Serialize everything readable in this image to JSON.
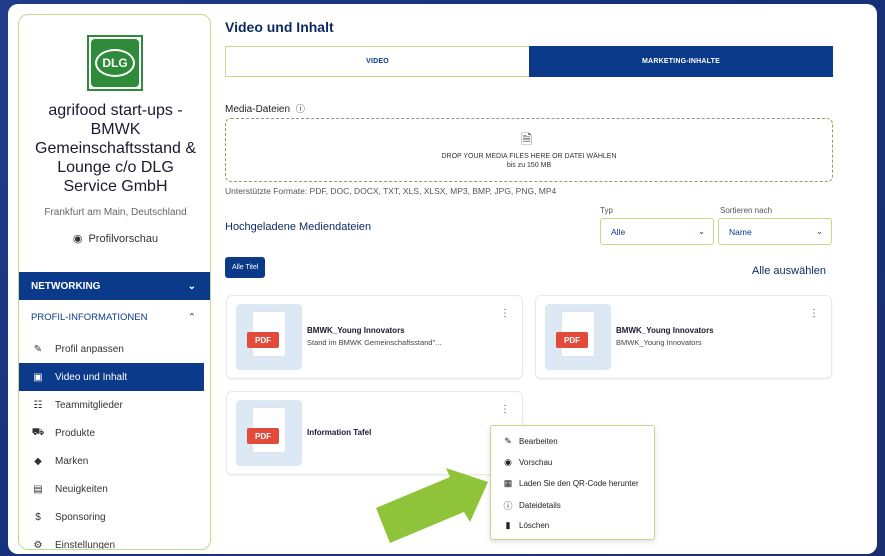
{
  "sidebar": {
    "company_lines": [
      "agrifood start-ups -",
      "BMWK",
      "Gemeinschaftsstand &",
      "Lounge c/o DLG",
      "Service GmbH"
    ],
    "logo_text": "DLG",
    "location": "Frankfurt am Main, Deutschland",
    "preview_label": "Profilvorschau",
    "networking_label": "NETWORKING",
    "profile_info_label": "PROFIL-INFORMATIONEN",
    "items": [
      {
        "label": "Profil anpassen",
        "icon": "pencil-icon"
      },
      {
        "label": "Video und Inhalt",
        "icon": "video-icon"
      },
      {
        "label": "Teammitglieder",
        "icon": "team-icon"
      },
      {
        "label": "Produkte",
        "icon": "cart-icon"
      },
      {
        "label": "Marken",
        "icon": "tag-icon"
      },
      {
        "label": "Neuigkeiten",
        "icon": "news-icon"
      },
      {
        "label": "Sponsoring",
        "icon": "dollar-icon"
      },
      {
        "label": "Einstellungen",
        "icon": "gear-icon"
      }
    ],
    "active_item": "Video und Inhalt"
  },
  "main": {
    "title": "Video und Inhalt",
    "tabs": [
      {
        "label": "VIDEO",
        "active": false
      },
      {
        "label": "MARKETING-INHALTE",
        "active": true
      }
    ],
    "media_label": "Media-Dateien",
    "drop_text": "DROP YOUR MEDIA FILES HERE OR DATEI WÄHLEN",
    "drop_limit": "bis zu 150 MB",
    "formats": "Unterstützte Formate: PDF, DOC, DOCX, TXT, XLS, XLSX, MP3, BMP, JPG, PNG, MP4",
    "uploaded_title": "Hochgeladene Mediendateien",
    "type_filter": {
      "label": "Typ",
      "value": "Alle"
    },
    "sort": {
      "label": "Sortieren nach",
      "value": "Name"
    },
    "all_titles_button": "Alle Titel",
    "select_all": "Alle auswählen",
    "files": [
      {
        "title": "BMWK_Young Innovators",
        "subtitle": "Stand im BMWK Gemeinschaftsstand\"...",
        "badge": "PDF"
      },
      {
        "title": "BMWK_Young Innovators",
        "subtitle": "BMWK_Young Innovators",
        "badge": "PDF"
      },
      {
        "title": "Information Tafel",
        "subtitle": "",
        "badge": "PDF"
      }
    ],
    "context_menu": [
      {
        "label": "Bearbeiten",
        "icon": "pencil-icon"
      },
      {
        "label": "Vorschau",
        "icon": "eye-icon"
      },
      {
        "label": "Laden Sie den QR-Code herunter",
        "icon": "qr-code-icon"
      },
      {
        "label": "Dateidetails",
        "icon": "info-icon"
      },
      {
        "label": "Löschen",
        "icon": "trash-icon"
      }
    ]
  },
  "colors": {
    "primary": "#0b3a8a",
    "accent_border": "#c6d88a",
    "arrow": "#8fc43a",
    "pdf_badge": "#e24b3b",
    "background": "#1f3d8a"
  }
}
